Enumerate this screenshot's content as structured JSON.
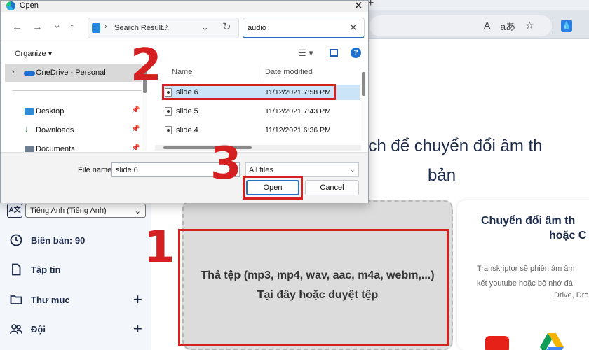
{
  "dialog": {
    "title": "Open",
    "close_glyph": "✕",
    "nav": {
      "back": "←",
      "forward": "→",
      "recent": "⌄",
      "up": "↑"
    },
    "address": {
      "sep_before": "›",
      "path": "Search Result...",
      "sep_after": "›",
      "dropdown": "⌄",
      "refresh": "↻"
    },
    "search": {
      "value": "audio",
      "clear": "✕"
    },
    "toolbar": {
      "organize": "Organize ▾",
      "view_glyph": "☰ ▾",
      "help": "?"
    },
    "nav_pane": {
      "onedrive": {
        "chevron": "›",
        "label": "OneDrive - Personal"
      },
      "quick_access": [
        {
          "label": "Desktop",
          "pin": "📌"
        },
        {
          "label": "Downloads",
          "pin": "📌"
        },
        {
          "label": "Documents",
          "pin": "📌"
        }
      ]
    },
    "columns": {
      "name": "Name",
      "date_modified": "Date modified"
    },
    "files": [
      {
        "name": "slide 6",
        "date": "11/12/2021 7:58 PM"
      },
      {
        "name": "slide 5",
        "date": "11/12/2021 7:43 PM"
      },
      {
        "name": "slide 4",
        "date": "11/12/2021 6:36 PM"
      }
    ],
    "file_name_label": "File name:",
    "file_name_value": "slide 6",
    "file_type": {
      "value": "All files",
      "chevron": "⌄"
    },
    "open_button": "Open",
    "cancel_button": "Cancel"
  },
  "browser": {
    "new_tab": "+",
    "icons": [
      "A",
      "aあ",
      "☆"
    ],
    "extension": "💧"
  },
  "webpage": {
    "hero_line1": "ách để chuyển đổi âm th",
    "hero_line2": "bản",
    "language_icon": "A文",
    "language": "Tiếng Anh (Tiếng Anh)",
    "language_chevron": "⌄",
    "sidebar": [
      {
        "label": "Biên bản: 90",
        "icon": "clock-icon"
      },
      {
        "label": "Tập tin",
        "icon": "file-icon"
      },
      {
        "label": "Thư mục",
        "icon": "folder-icon",
        "plus": "+"
      },
      {
        "label": "Đội",
        "icon": "team-icon",
        "plus": "+"
      }
    ],
    "dropzone": "Thả tệp (mp3, mp4, wav, aac, m4a, webm,...) Tại đây hoặc duyệt tệp",
    "card": {
      "title": "Chuyển đổi âm th",
      "title2": "hoặc C",
      "desc1": "Transkriptor sẽ phiên âm âm",
      "desc2": "kết youtube hoặc bộ nhớ đá",
      "desc3": "Drive, Dro"
    }
  },
  "annotations": [
    "1",
    "2",
    "3"
  ]
}
